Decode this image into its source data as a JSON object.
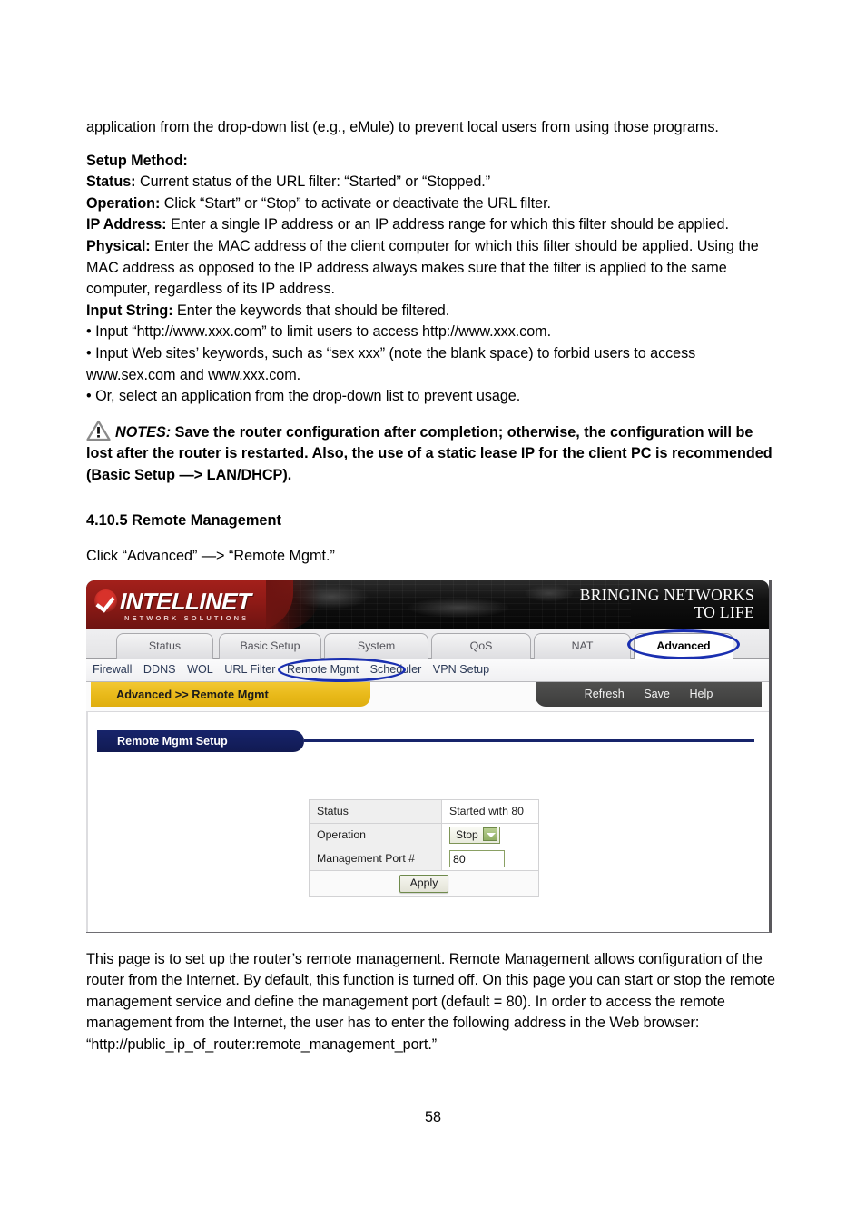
{
  "document": {
    "page_number": "58",
    "paragraphs": {
      "intro": "application from the drop-down list (e.g., eMule) to prevent local users from using those programs.",
      "setup_method_heading": "Setup Method:",
      "status_label": "Status:",
      "status_text": " Current status of the URL filter: “Started” or “Stopped.”",
      "operation_label": "Operation:",
      "operation_text": " Click “Start” or “Stop” to activate or deactivate the URL filter.",
      "ip_address_label": "IP Address:",
      "ip_address_text": " Enter a single IP address or an IP address range for which this filter should be applied.",
      "physical_label": "Physical:",
      "physical_text": " Enter the MAC address of the client computer for which this filter should be applied. Using the MAC address as opposed to the IP address always makes sure that the filter is applied to the same computer, regardless of its IP address.",
      "input_string_label": "Input String:",
      "input_string_text": " Enter the keywords that should be filtered.",
      "bullet_1": "• Input “http://www.xxx.com” to limit users to access http://www.xxx.com.",
      "bullet_2": "• Input Web sites’ keywords, such as “sex xxx” (note the blank space) to forbid users to access www.sex.com and www.xxx.com.",
      "bullet_3": "• Or, select an application from the drop-down list to prevent usage.",
      "notes_label": "NOTES:",
      "notes_text": " Save the router configuration after completion; otherwise, the configuration will be lost after the router is restarted. Also, the use of a static lease IP for the client PC is recommended (Basic Setup —> LAN/DHCP).",
      "section_heading": "4.10.5 Remote Management",
      "click_path": "Click “Advanced” —> “Remote Mgmt.”",
      "closing": "This page is to set up the router’s remote management. Remote Management allows configuration of the router from the Internet. By default, this function is turned off. On this page you can start or stop the remote management service and define the management port (default = 80). In order to access the remote management from the Internet, the user has to enter the following address in the Web browser: “http://public_ip_of_router:remote_management_port.”"
    }
  },
  "router_ui": {
    "banner": {
      "brand": "INTELLINET",
      "brand_sub": "NETWORK SOLUTIONS",
      "tagline_line1": "BRINGING NETWORKS",
      "tagline_line2": "TO LIFE"
    },
    "tabs": [
      {
        "label": "Status",
        "active": false
      },
      {
        "label": "Basic Setup",
        "active": false
      },
      {
        "label": "System",
        "active": false
      },
      {
        "label": "QoS",
        "active": false
      },
      {
        "label": "NAT",
        "active": false
      },
      {
        "label": "Advanced",
        "active": true
      }
    ],
    "subnav": [
      {
        "label": "Firewall"
      },
      {
        "label": "DDNS"
      },
      {
        "label": "WOL"
      },
      {
        "label": "URL Filter"
      },
      {
        "label": "Remote Mgmt"
      },
      {
        "label": "Scheduler"
      },
      {
        "label": "VPN Setup"
      }
    ],
    "breadcrumb": "Advanced >> Remote Mgmt",
    "actions": {
      "refresh": "Refresh",
      "save": "Save",
      "help": "Help"
    },
    "section_title": "Remote Mgmt Setup",
    "form": {
      "rows": [
        {
          "label": "Status",
          "value": "Started with 80",
          "type": "text"
        },
        {
          "label": "Operation",
          "value": "Stop",
          "type": "select"
        },
        {
          "label": "Management Port #",
          "value": "80",
          "type": "input"
        }
      ],
      "apply_label": "Apply"
    },
    "highlight_color": "#1a2fb0",
    "accent_colors": {
      "logo_red": "#8e1a16",
      "breadcrumb_yellow": "#e8b919",
      "section_navy": "#17246b",
      "action_gray": "#46463f"
    }
  }
}
